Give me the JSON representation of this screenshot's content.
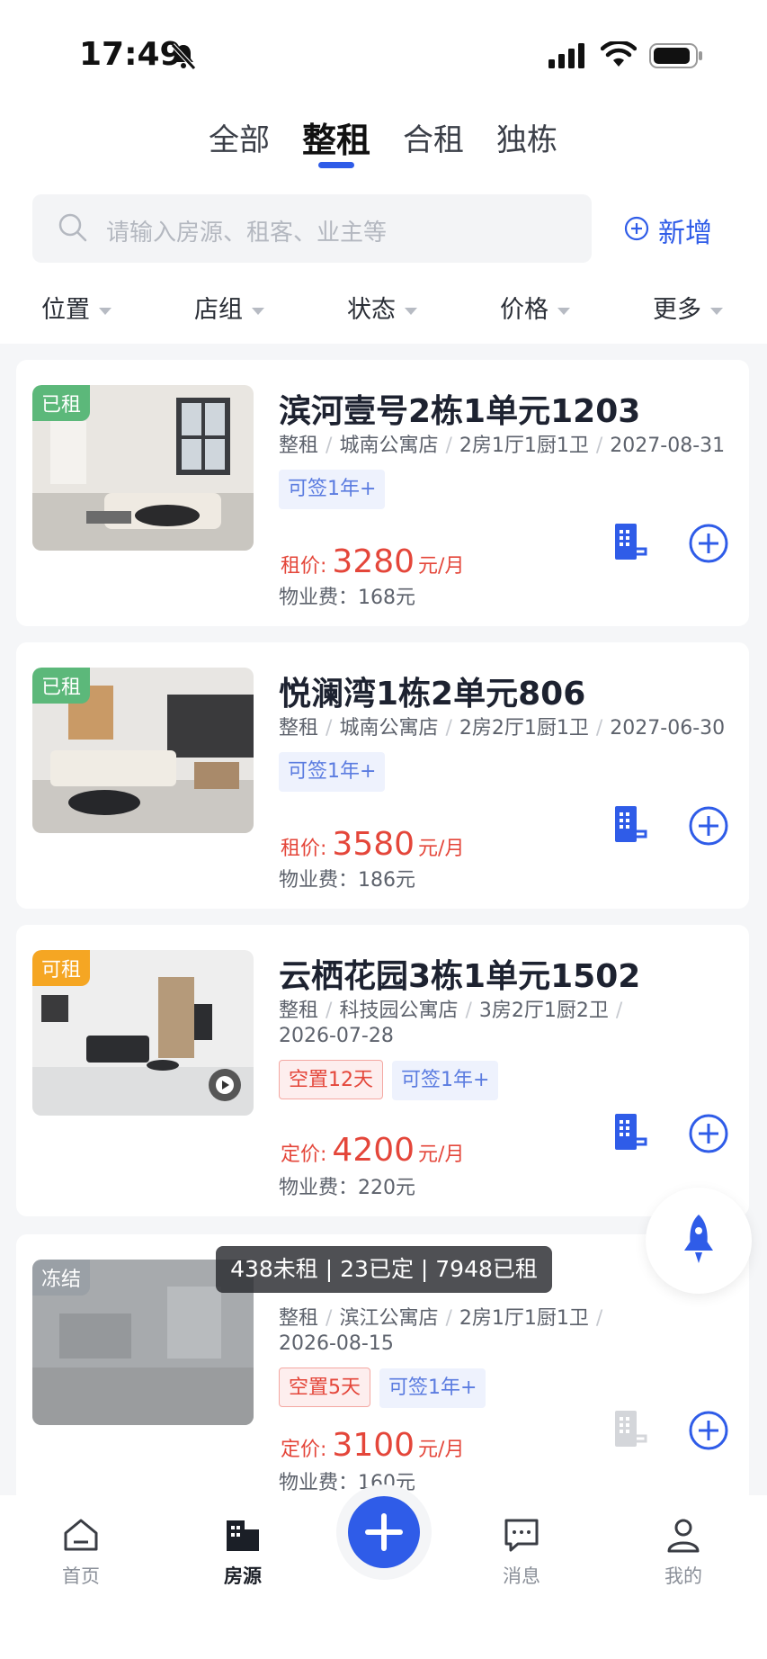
{
  "status_bar": {
    "time": "17:49"
  },
  "tabs": [
    {
      "label": "全部"
    },
    {
      "label": "整租"
    },
    {
      "label": "合租"
    },
    {
      "label": "独栋"
    }
  ],
  "active_tab": "整租",
  "search": {
    "placeholder": "请输入房源、租客、业主等"
  },
  "add_new_label": "新增",
  "filters": [
    {
      "label": "位置"
    },
    {
      "label": "店组"
    },
    {
      "label": "状态"
    },
    {
      "label": "价格"
    },
    {
      "label": "更多"
    }
  ],
  "listings": [
    {
      "status": "已租",
      "status_color": "#5cb87a",
      "title": "滨河壹号2栋1单元1203",
      "type": "整租",
      "store": "城南公寓店",
      "layout": "2房1厅1厨1卫",
      "date": "2027-08-31",
      "tags": [
        "可签1年+"
      ],
      "price_label": "租价:",
      "price": "3280",
      "price_unit": "元/月",
      "fee": "物业费：168元",
      "lock_active": true
    },
    {
      "status": "已租",
      "status_color": "#5cb87a",
      "title": "悦澜湾1栋2单元806",
      "type": "整租",
      "store": "城南公寓店",
      "layout": "2房2厅1厨1卫",
      "date": "2027-06-30",
      "tags": [
        "可签1年+"
      ],
      "price_label": "租价:",
      "price": "3580",
      "price_unit": "元/月",
      "fee": "物业费：186元",
      "lock_active": true
    },
    {
      "status": "可租",
      "status_color": "#f5a623",
      "title": "云栖花园3栋1单元1502",
      "type": "整租",
      "store": "科技园公寓店",
      "layout": "3房2厅1厨2卫",
      "date": "2026-07-28",
      "vacancy": "空置12天",
      "tags": [
        "可签1年+"
      ],
      "price_label": "定价:",
      "price": "4200",
      "price_unit": "元/月",
      "fee": "物业费：220元",
      "lock_active": true
    },
    {
      "status": "冻结",
      "status_color": "#9aa0a6",
      "title": "",
      "type": "整租",
      "store": "滨江公寓店",
      "layout": "2房1厅1厨1卫",
      "date": "2026-08-15",
      "vacancy": "空置5天",
      "tags": [
        "可签1年+"
      ],
      "price_label": "定价:",
      "price": "3100",
      "price_unit": "元/月",
      "fee": "物业费：160元",
      "lock_active": false
    }
  ],
  "toast": "438未租 | 23已定 | 7948已租",
  "bottom_nav": [
    {
      "label": "首页",
      "icon": "home-icon"
    },
    {
      "label": "房源",
      "icon": "building-icon"
    },
    {
      "label": "消息",
      "icon": "message-icon"
    },
    {
      "label": "我的",
      "icon": "user-icon"
    }
  ],
  "colors": {
    "accent": "#2f5ce8",
    "price_red": "#e4463a"
  }
}
